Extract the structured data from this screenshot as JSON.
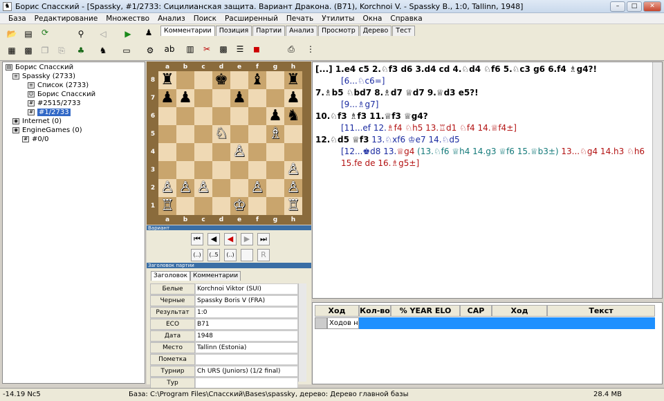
{
  "window": {
    "title": "Борис Спасский - [Spassky, #1/2733: Сицилианская защита. Вариант Дракона. (B71), Korchnoi V. - Spassky B., 1:0, Tallinn, 1948]"
  },
  "menu": [
    "База",
    "Редактирование",
    "Множество",
    "Анализ",
    "Поиск",
    "Расширенный",
    "Печать",
    "Утилиты",
    "Окна",
    "Справка"
  ],
  "tabs": [
    "Комментарии",
    "Позиция",
    "Партии",
    "Анализ",
    "Просмотр",
    "Дерево",
    "Тест"
  ],
  "tree": {
    "root": "Борис Спасский",
    "db": "Spassky (2733)",
    "list": "Список (2733)",
    "player": "Борис Спасский",
    "range": "#2515/2733",
    "current": "#1/2733",
    "internet": "Internet (0)",
    "engine": "EngineGames (0)",
    "engine_child": "#0/0"
  },
  "board": {
    "files": [
      "a",
      "b",
      "c",
      "d",
      "e",
      "f",
      "g",
      "h"
    ],
    "ranks": [
      "8",
      "7",
      "6",
      "5",
      "4",
      "3",
      "2",
      "1"
    ],
    "rows": [
      [
        "♜",
        "",
        "",
        "♚",
        "",
        "♝",
        "",
        "♜"
      ],
      [
        "♟",
        "♟",
        "",
        "",
        "♟",
        "",
        "",
        "♟"
      ],
      [
        "",
        "",
        "",
        "",
        "",
        "",
        "♟",
        "♞"
      ],
      [
        "",
        "",
        "",
        "♘",
        "",
        "",
        "♗",
        ""
      ],
      [
        "",
        "",
        "",
        "",
        "♙",
        "",
        "",
        ""
      ],
      [
        "",
        "",
        "",
        "",
        "",
        "",
        "",
        "♙"
      ],
      [
        "♙",
        "♙",
        "♙",
        "",
        "",
        "♙",
        "",
        "♙"
      ],
      [
        "♖",
        "",
        "",
        "",
        "♔",
        "",
        "",
        "♖"
      ]
    ],
    "white_squares": [
      "d5",
      "g5",
      "e4",
      "h3",
      "a2",
      "b2",
      "c2",
      "f2",
      "h2",
      "a1",
      "e1",
      "h1"
    ]
  },
  "panels": {
    "variant": "Вариант",
    "header": "Заголовок партии"
  },
  "nav": {
    "prev_var": "(..)",
    "var_mark": "(..5",
    "next_var": "(..)"
  },
  "header_tabs": [
    "Заголовок",
    "Комментарии"
  ],
  "header_rows": [
    {
      "k": "Белые",
      "v": "Korchnoi Viktor (SUI)"
    },
    {
      "k": "Черные",
      "v": "Spassky Boris V (FRA)"
    },
    {
      "k": "Результат",
      "v": "1:0"
    },
    {
      "k": "ECO",
      "v": "B71"
    },
    {
      "k": "Дата",
      "v": "1948"
    },
    {
      "k": "Место",
      "v": "Tallinn (Estonia)"
    },
    {
      "k": "Пометка",
      "v": ""
    },
    {
      "k": "Турнир",
      "v": "Ch URS (Juniors) (1/2 final)"
    },
    {
      "k": "Тур",
      "v": ""
    }
  ],
  "notation": {
    "l1": "[...] 1.e4 c5 2.♘f3 d6 3.d4 cd 4.♘d4 ♘f6 5.♘c3 g6 6.f4 ♗g4?!",
    "v1": "[6...♘c6=]",
    "l2": "7.♗b5 ♘bd7 8.♗d7 ♕d7 9.♕d3 e5?!",
    "v2": "[9...♗g7]",
    "l3": "10.♘f3 ♗f3 11.♕f3 ♕g4?",
    "v3a": "[11...ef 12.",
    "v3b": "♗f4 ♘h5 13.♖d1 ♘f4 14.♕f4±]",
    "l4a": "12.♘d5 ♕f3",
    "l4b": " 13.♘xf6 ♔e7 14.♘d5",
    "v4a": "[12...♚d8 13.",
    "v4b": "♕g4",
    "v4c": " (13.♘f6 ♕h4 14.g3 ♕f6 15.♕b3±)",
    "v4d": " 13...♘g4 14.h3 ♘h6",
    "v4e": "15.fe de 16.",
    "v4f": "♗g5±]"
  },
  "engine": {
    "cols": [
      "Ход",
      "Кол-во",
      "% YEAR ELO",
      "CAP",
      "Ход программ",
      "Текст"
    ],
    "row": "Ходов не"
  },
  "status": {
    "eval": "-14.19 Nc5",
    "path": "База: C:\\Program Files\\Спасский\\Bases\\spassky, дерево: Дерево главной базы",
    "mem": "28.4 MB"
  }
}
